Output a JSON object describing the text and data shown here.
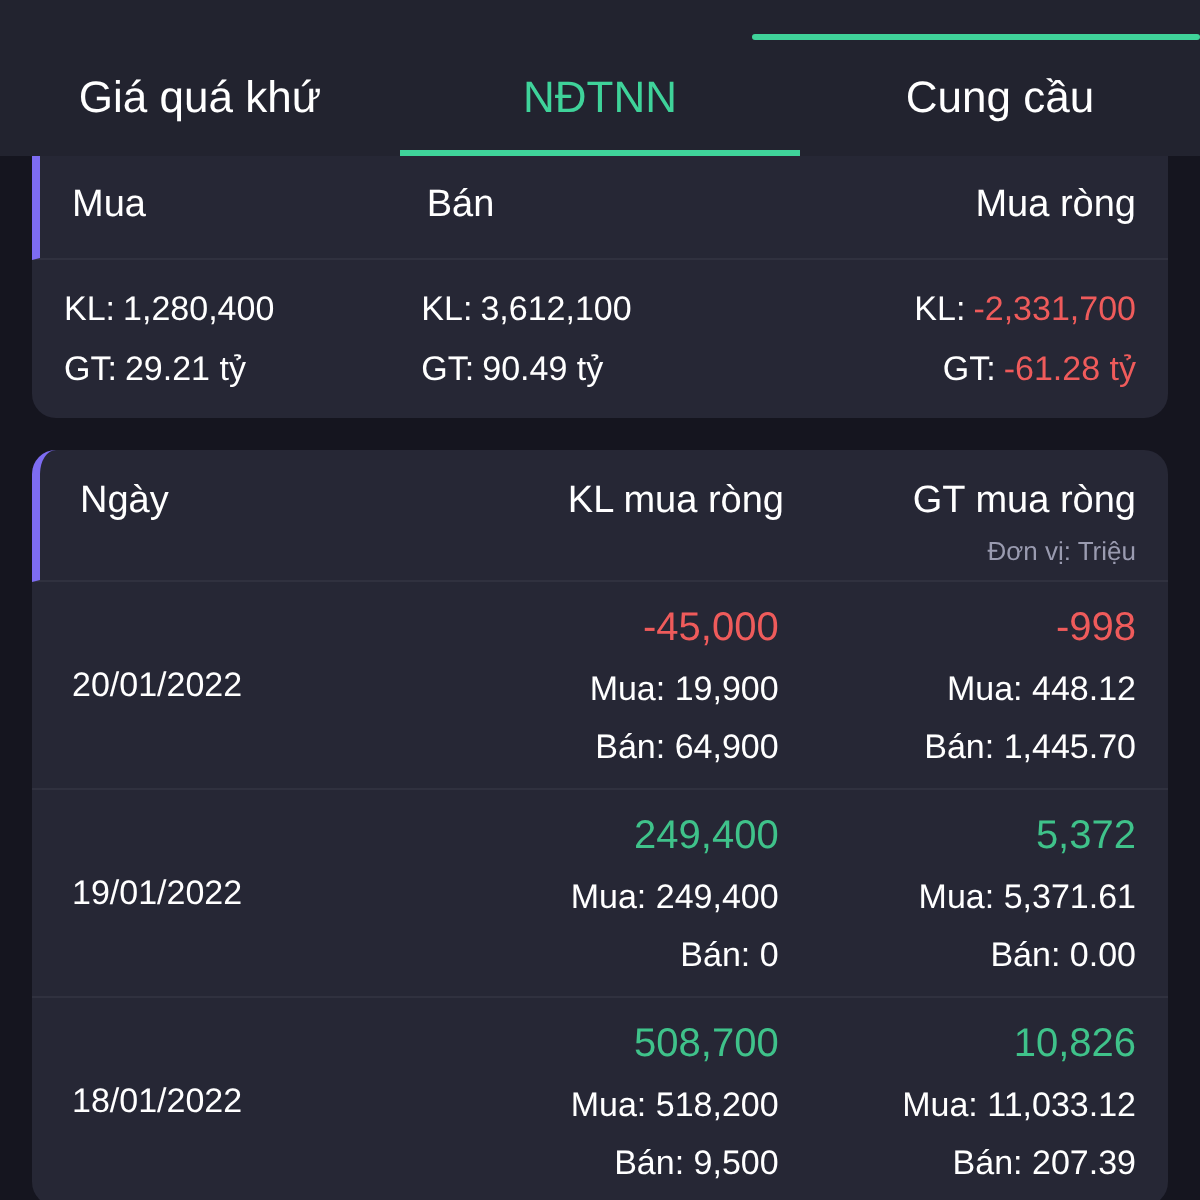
{
  "tabs": [
    {
      "label": "Giá quá khứ",
      "selected": false
    },
    {
      "label": "NĐTNN",
      "selected": true
    },
    {
      "label": "Cung cầu",
      "selected": false
    }
  ],
  "summary": {
    "columns": [
      "Mua",
      "Bán",
      "Mua ròng"
    ],
    "cells": [
      {
        "kl_label": "KL:",
        "kl": "1,280,400",
        "gt_label": "GT:",
        "gt": "29.21 tỷ",
        "color": "#ffffff"
      },
      {
        "kl_label": "KL:",
        "kl": "3,612,100",
        "gt_label": "GT:",
        "gt": "90.49 tỷ",
        "color": "#ffffff"
      },
      {
        "kl_label": "KL:",
        "kl": "-2,331,700",
        "gt_label": "GT:",
        "gt": "-61.28 tỷ",
        "color": "#ef5b5b"
      }
    ]
  },
  "table": {
    "columns": [
      "Ngày",
      "KL mua ròng",
      "GT mua ròng"
    ],
    "unit_note": "Đơn vị: Triệu",
    "rows": [
      {
        "date": "20/01/2022",
        "color": "#ef5b5b",
        "kl_net": "-45,000",
        "kl_buy": "Mua: 19,900",
        "kl_sell": "Bán: 64,900",
        "gt_net": "-998",
        "gt_buy": "Mua: 448.12",
        "gt_sell": "Bán: 1,445.70"
      },
      {
        "date": "19/01/2022",
        "color": "#3fc28a",
        "kl_net": "249,400",
        "kl_buy": "Mua: 249,400",
        "kl_sell": "Bán: 0",
        "gt_net": "5,372",
        "gt_buy": "Mua: 5,371.61",
        "gt_sell": "Bán: 0.00"
      },
      {
        "date": "18/01/2022",
        "color": "#3fc28a",
        "kl_net": "508,700",
        "kl_buy": "Mua: 518,200",
        "kl_sell": "Bán: 9,500",
        "gt_net": "10,826",
        "gt_buy": "Mua: 11,033.12",
        "gt_sell": "Bán: 207.39"
      }
    ]
  }
}
